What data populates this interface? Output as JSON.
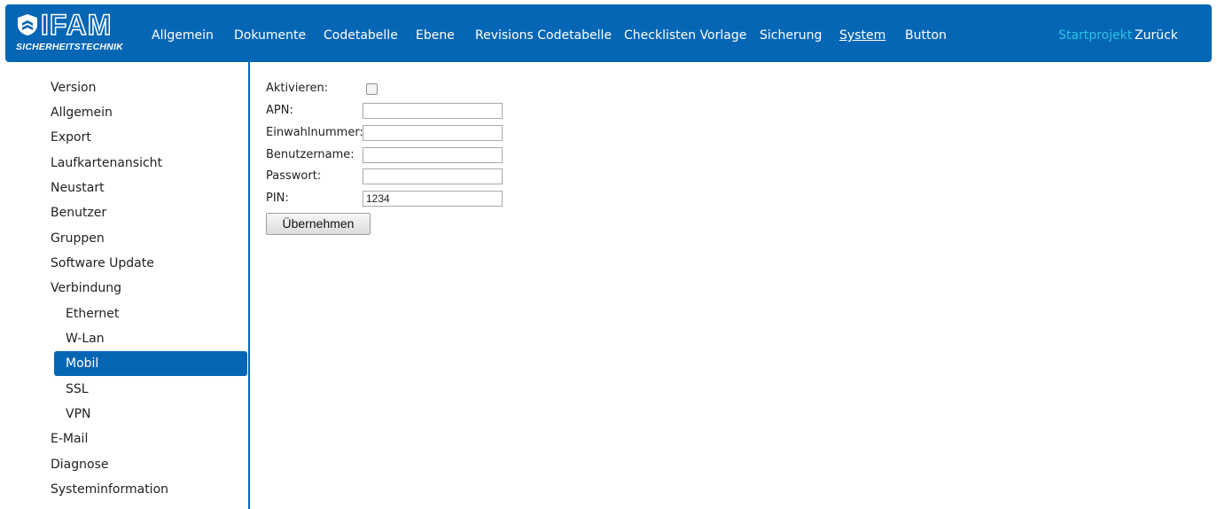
{
  "logo": {
    "word": "IFAM",
    "subtitle": "SICHERHEITSTECHNIK"
  },
  "nav": {
    "items": [
      {
        "label": "Allgemein"
      },
      {
        "label": "Dokumente"
      },
      {
        "label": "Codetabelle"
      },
      {
        "label": "Ebene"
      },
      {
        "label": "Revisions Codetabelle"
      },
      {
        "label": "Checklisten Vorlage"
      },
      {
        "label": "Sicherung"
      },
      {
        "label": "System",
        "active": true
      },
      {
        "label": "Button"
      }
    ],
    "right": [
      {
        "label": "Startprojekt",
        "color": "#29c4e3"
      },
      {
        "label": "Zurück"
      }
    ],
    "color": "#0566b5"
  },
  "sidebar": {
    "items": [
      {
        "label": "Version"
      },
      {
        "label": "Allgemein"
      },
      {
        "label": "Export"
      },
      {
        "label": "Laufkartenansicht"
      },
      {
        "label": "Neustart"
      },
      {
        "label": "Benutzer"
      },
      {
        "label": "Gruppen"
      },
      {
        "label": "Software Update"
      },
      {
        "label": "Verbindung"
      },
      {
        "label": "Ethernet",
        "sub": true
      },
      {
        "label": "W-Lan",
        "sub": true
      },
      {
        "label": "Mobil",
        "sub": true,
        "selected": true
      },
      {
        "label": "SSL",
        "sub": true
      },
      {
        "label": "VPN",
        "sub": true
      },
      {
        "label": "E-Mail"
      },
      {
        "label": "Diagnose"
      },
      {
        "label": "Systeminformation"
      }
    ]
  },
  "form": {
    "activate_label": "Aktivieren:",
    "activate_checked": false,
    "apn_label": "APN:",
    "apn_value": "",
    "dial_label": "Einwahlnummer:",
    "dial_value": "",
    "user_label": "Benutzername:",
    "user_value": "",
    "password_label": "Passwort:",
    "password_value": "",
    "pin_label": "PIN:",
    "pin_value": "1234",
    "apply_label": "Übernehmen"
  }
}
